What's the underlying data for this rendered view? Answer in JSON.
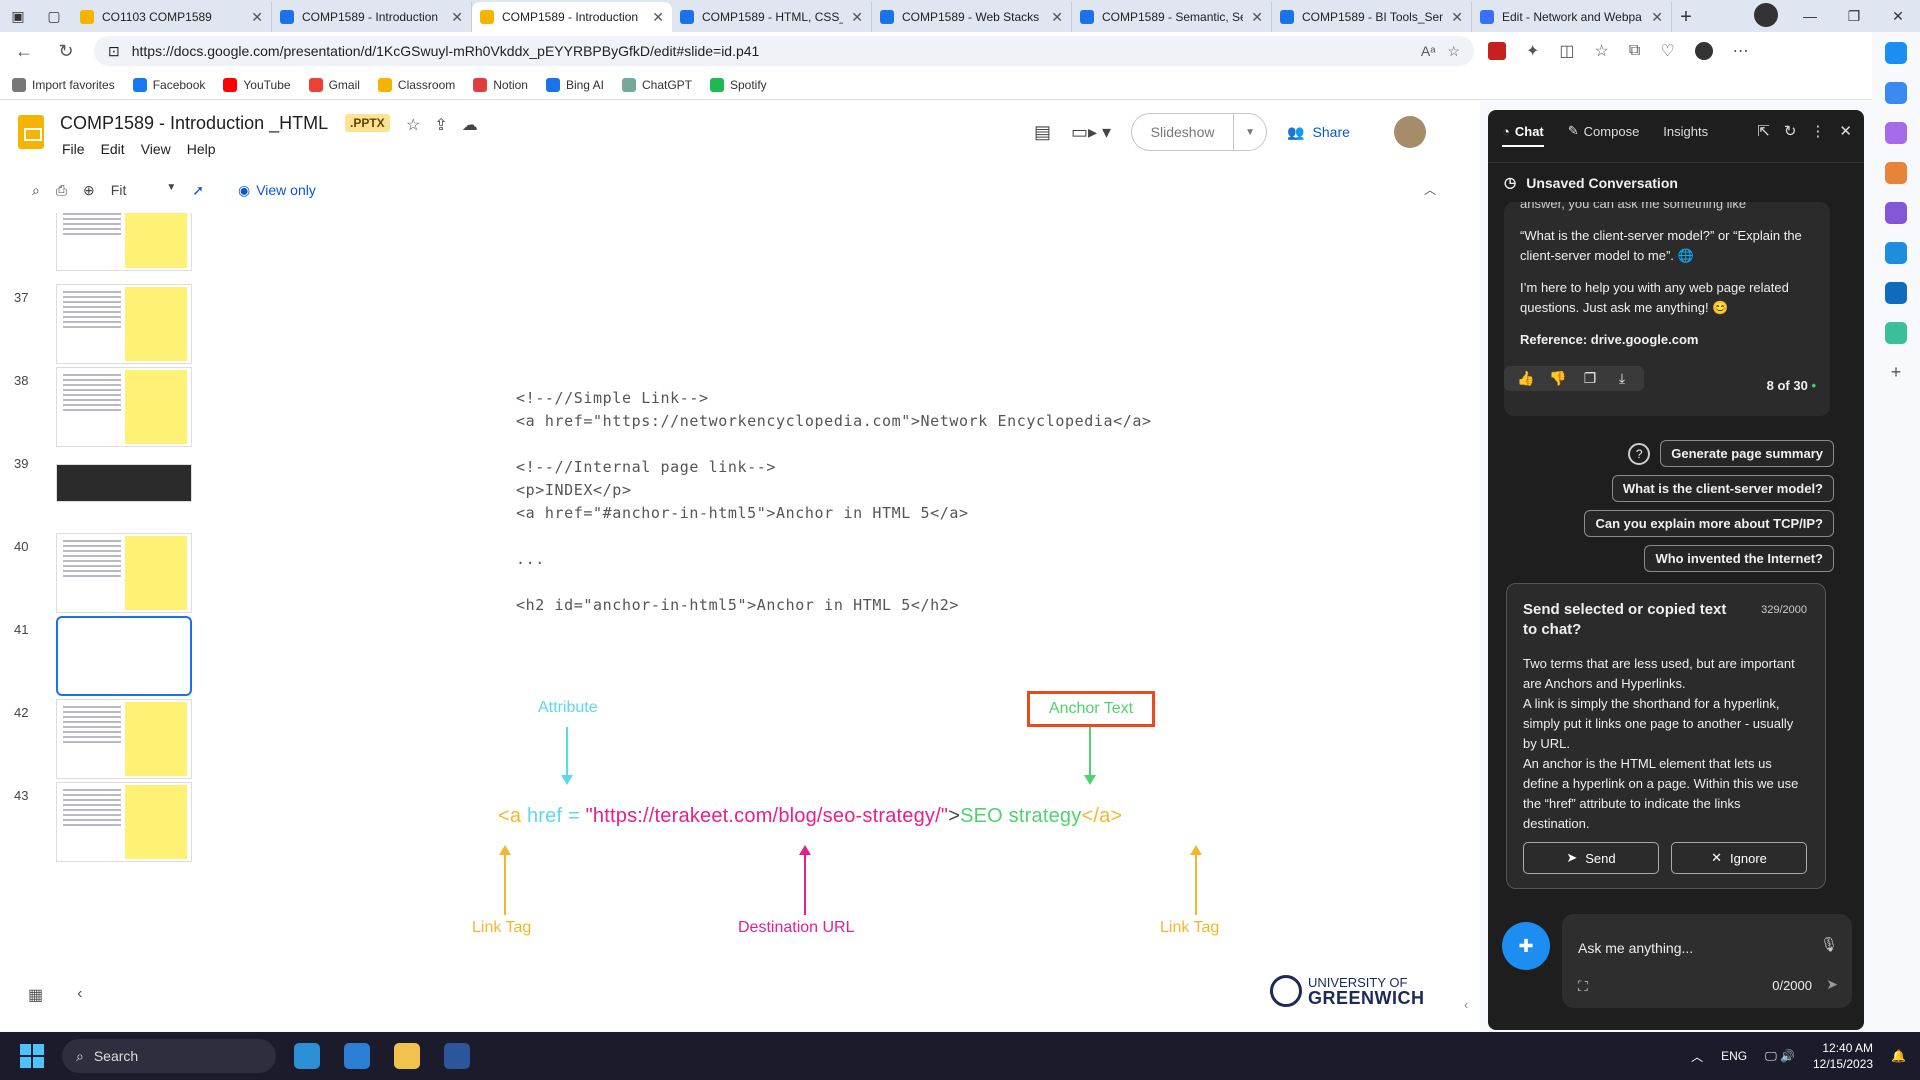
{
  "browser": {
    "tabs": [
      {
        "label": "CO1103 COMP1589",
        "color": "#f4b400",
        "active": false
      },
      {
        "label": "COMP1589 - Introduction",
        "color": "#1a73e8",
        "active": false
      },
      {
        "label": "COMP1589 - Introduction",
        "color": "#f4b400",
        "active": true
      },
      {
        "label": "COMP1589 - HTML, CSS_",
        "color": "#1a73e8",
        "active": false
      },
      {
        "label": "COMP1589 - Web Stacks",
        "color": "#1a73e8",
        "active": false
      },
      {
        "label": "COMP1589 - Semantic, Se",
        "color": "#1a73e8",
        "active": false
      },
      {
        "label": "COMP1589 - BI Tools_Sen",
        "color": "#1a73e8",
        "active": false
      },
      {
        "label": "Edit - Network and Webpa",
        "color": "#3a6ff7",
        "active": false
      }
    ],
    "url": "https://docs.google.com/presentation/d/1KcGSwuyl-mRh0Vkddx_pEYYRBPByGfkD/edit#slide=id.p41",
    "bookmarks": [
      {
        "label": "Import favorites",
        "color": "#777777"
      },
      {
        "label": "Facebook",
        "color": "#1877f2"
      },
      {
        "label": "YouTube",
        "color": "#ff0000"
      },
      {
        "label": "Gmail",
        "color": "#ea4335"
      },
      {
        "label": "Classroom",
        "color": "#f4b400"
      },
      {
        "label": "Notion",
        "color": "#e03e3e"
      },
      {
        "label": "Bing AI",
        "color": "#1a73e8"
      },
      {
        "label": "ChatGPT",
        "color": "#74aa9c"
      },
      {
        "label": "Spotify",
        "color": "#1db954"
      }
    ]
  },
  "doc": {
    "title": "COMP1589 - Introduction _HTML",
    "badge": ".PPTX",
    "menu": [
      "File",
      "Edit",
      "View",
      "Help"
    ],
    "zoom": "Fit",
    "view_only": "View only",
    "slideshow": "Slideshow",
    "share": "Share"
  },
  "filmstrip": [
    {
      "num": "",
      "kind": "text-yellow"
    },
    {
      "num": "37",
      "kind": "text-icon"
    },
    {
      "num": "38",
      "kind": "text-yellow"
    },
    {
      "num": "39",
      "kind": "dark"
    },
    {
      "num": "40",
      "kind": "text-icon"
    },
    {
      "num": "41",
      "kind": "selected"
    },
    {
      "num": "42",
      "kind": "text-image"
    },
    {
      "num": "43",
      "kind": "text-icon"
    }
  ],
  "slide": {
    "code_lines": [
      "<!--//Simple Link-->",
      "<a href=\"https://networkencyclopedia.com\">Network Encyclopedia</a>",
      "",
      "<!--//Internal page link-->",
      "<p>INDEX</p>",
      "<a href=\"#anchor-in-html5\">Anchor in HTML 5</a>",
      "",
      "...",
      "",
      "<h2 id=\"anchor-in-html5\">Anchor in HTML 5</h2>"
    ],
    "attribute_label": "Attribute",
    "anchor_text_label": "Anchor Text",
    "anchor_parts": {
      "open": "<a ",
      "attr": " href = ",
      "url": "\"https://terakeet.com/blog/seo-strategy/\"",
      "gt": ">",
      "text": "SEO strategy",
      "close": "</a>"
    },
    "link_tag_left": "Link Tag",
    "destination_url": "Destination URL",
    "link_tag_right": "Link Tag",
    "uni_line1": "UNIVERSITY OF",
    "uni_line2": "GREENWICH",
    "colors": {
      "tag": "#f5b62b",
      "attr": "#5ad8ef",
      "url": "#e91e8c",
      "text": "#4fd36b",
      "box": "#e84a1c"
    }
  },
  "copilot": {
    "tabs": [
      "Chat",
      "Compose",
      "Insights"
    ],
    "conversation_title": "Unsaved Conversation",
    "message_cut": "answer, you can ask me something like",
    "message_p1": "“What is the client-server model?” or “Explain the client-server model to me”. 🌐",
    "message_p2": "I’m here to help you with any web page related questions. Just ask me anything! 😊",
    "reference": "Reference: drive.google.com",
    "page_count": "8 of 30",
    "suggestions": [
      "Generate page summary",
      "What is the client-server model?",
      "Can you explain more about TCP/IP?",
      "Who invented the Internet?"
    ],
    "send_card": {
      "title": "Send selected or copied text to chat?",
      "count": "329/2000",
      "body": "Two terms that are less used, but are important are Anchors and Hyperlinks.\nA link is simply the shorthand for a hyperlink, simply put it links one page to another - usually by URL.\nAn anchor is the HTML element that lets us define a hyperlink on a page. Within this we use the “href” attribute to indicate the links destination.",
      "send": "Send",
      "ignore": "Ignore"
    },
    "input_placeholder": "Ask me anything...",
    "input_count": "0/2000"
  },
  "taskbar": {
    "search": "Search",
    "lang": "ENG",
    "time": "12:40 AM",
    "date": "12/15/2023"
  }
}
